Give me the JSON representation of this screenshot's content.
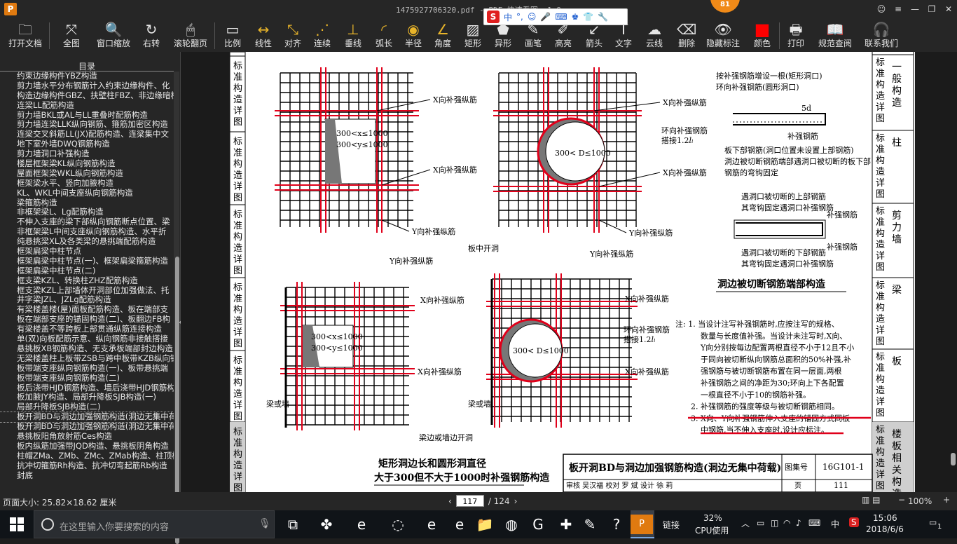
{
  "window": {
    "title": "1475927706320.pdf - PDF 快速看图 v1.9",
    "notification_count": "81"
  },
  "ime": {
    "mode": "中"
  },
  "toolbar": [
    {
      "name": "open-document",
      "label": "打开文档",
      "icon": "folder-icon"
    },
    {
      "name": "full-view",
      "label": "全图",
      "icon": "fullscreen-icon"
    },
    {
      "name": "window-zoom",
      "label": "窗口缩放",
      "icon": "magnifier-icon"
    },
    {
      "name": "rotate-right",
      "label": "右转",
      "icon": "rotate-icon"
    },
    {
      "name": "scroll-page",
      "label": "滚轮翻页",
      "icon": "mouse-icon"
    },
    {
      "name": "scale",
      "label": "比例",
      "icon": "ruler-icon"
    },
    {
      "name": "linear",
      "label": "线性",
      "icon": "linear-dim-icon"
    },
    {
      "name": "aligned",
      "label": "对齐",
      "icon": "aligned-dim-icon"
    },
    {
      "name": "continuous",
      "label": "连续",
      "icon": "continuous-dim-icon"
    },
    {
      "name": "perpendicular",
      "label": "垂线",
      "icon": "perpendicular-icon"
    },
    {
      "name": "arc-length",
      "label": "弧长",
      "icon": "arc-icon"
    },
    {
      "name": "radius",
      "label": "半径",
      "icon": "radius-icon"
    },
    {
      "name": "angle",
      "label": "角度",
      "icon": "angle-icon"
    },
    {
      "name": "rectangle",
      "label": "矩形",
      "icon": "rectangle-icon"
    },
    {
      "name": "irregular",
      "label": "异形",
      "icon": "polygon-icon"
    },
    {
      "name": "brush",
      "label": "画笔",
      "icon": "pen-icon"
    },
    {
      "name": "highlight",
      "label": "高亮",
      "icon": "highlighter-icon"
    },
    {
      "name": "arrow",
      "label": "箭头",
      "icon": "arrow-icon"
    },
    {
      "name": "text",
      "label": "文字",
      "icon": "text-icon"
    },
    {
      "name": "cloud",
      "label": "云线",
      "icon": "cloud-icon"
    },
    {
      "name": "delete",
      "label": "删除",
      "icon": "eraser-icon"
    },
    {
      "name": "hide-markup",
      "label": "隐藏标注",
      "icon": "eye-hidden-icon"
    },
    {
      "name": "color",
      "label": "颜色",
      "icon": "color-swatch-icon",
      "color": "#ff0000"
    },
    {
      "name": "print",
      "label": "打印",
      "icon": "printer-icon"
    },
    {
      "name": "spec-lookup",
      "label": "规范查阅",
      "icon": "book-icon"
    },
    {
      "name": "contact",
      "label": "联系我们",
      "icon": "headset-icon"
    }
  ],
  "sidebar": {
    "title": "目录",
    "items": [
      "约束边缘构件YBZ构造",
      "剪力墙水平分布钢筋计入约束边缘构件、化",
      "构造边缘构件GBZ、扶壁柱FBZ、非边缘暗柱",
      "连梁LL配筋构造",
      "剪力墙BKL或AL与LL重叠时配筋构造",
      "剪力墙连梁LLK纵向钢筋、箍筋加密区构造",
      "连梁交叉斜筋LL(JX)配筋构造、连梁集中文",
      "地下室外墙DWQ钢筋构造",
      "剪力墙洞口补强构造",
      "楼层框架梁KL纵向钢筋构造",
      "屋面框架梁WKL纵向钢筋构造",
      "框架梁水平、竖向加腋构造",
      "KL、WKL中间支座纵向钢筋构造",
      "梁箍筋构造",
      "非框架梁L、Lg配筋构造",
      "不伸入支座的梁下部纵向钢筋断点位置、梁",
      "非框架梁L中间支座纵向钢筋构造、水平折",
      "纯悬挑梁XL及各类梁的悬挑端配筋构造",
      "框架扁梁中柱节点",
      "框架扁梁中柱节点(一)、框架扁梁箍筋构造",
      "框架扁梁中柱节点(二)",
      "框支梁KZL、转换柱ZHZ配筋构造",
      "框支梁KZL上部墙体开洞部位加强做法、托",
      "井字梁JZL、JZLg配筋构造",
      "有梁楼盖楼(屋)面板配筋构造、板在端部支",
      "板在端部支座的锚固构造(二)、板翻边FB构",
      "有梁楼盖不等跨板上部贯通纵筋连接构造",
      "单(双)向板配筋示意、纵向钢筋非接触搭接",
      "悬挑板XB钢筋构造、无支承板端部封边构造",
      "无梁楼盖柱上板带ZSB与跨中板带KZB纵向钢",
      "板带端支座纵向钢筋构造(一)、板带悬挑端",
      "板带端支座纵向钢筋构造(二)",
      "板后浇带HJD钢筋构造、墙后浇带HJD钢筋构",
      "板加腋JY构造、局部升降板SJB构造(一)",
      "局部升降板SJB构造(二)",
      "板开洞BD与洞边加强钢筋构造(洞边无集中荷",
      "板开洞BD与洞边加强钢筋构造(洞边无集中荷",
      "悬挑板阳角放射筋Ces构造",
      "板内纵筋加强带JQD构造、悬挑板阴角构造",
      "柱帽ZMa、ZMb、ZMc、ZMab构造、柱顶柱帽",
      "抗冲切箍筋Rh构造、抗冲切弯起筋Rb构造",
      "封底"
    ],
    "selected_index": 35
  },
  "status": {
    "page_size": "页面大小: 25.82×18.62 厘米",
    "current_page": "117",
    "total_pages": "/ 124",
    "zoom": "100%"
  },
  "drawing": {
    "side_tab_left": "标准构造详图",
    "right_tabs": [
      "一般构造",
      "柱",
      "剪力墙",
      "梁",
      "板",
      "楼板相关构造"
    ],
    "right_tab_prefix": "标准构造详图",
    "labels": {
      "x_bar": "X向补强纵筋",
      "y_bar": "Y向补强纵筋",
      "ring_bar": "环向补强钢筋",
      "lap": "搭接1.2",
      "rect_size_x": "300<x≤1000",
      "rect_size_y": "300<y≤1000",
      "circle_size": "300< D≤1000",
      "slab_middle": "板中开洞",
      "beam_or_wall": "梁或墙",
      "edge_opening": "梁边或墙边开洞",
      "main_caption_1": "矩形洞边长和圆形洞直径",
      "main_caption_2": "大于300但不大于1000时补强钢筋构造",
      "right_note_1": "按补强钢筋增设一根(矩形洞口)",
      "right_note_2": "环向补强钢筋(圆形洞口)",
      "hook": "5d",
      "reinf_bar": "补强钢筋",
      "slab_bottom_1": "板下部钢筋(洞口位置未设置上部钢筋)",
      "slab_bottom_2": "洞边被切断钢筋端部遇洞口被切断的板下部",
      "slab_bottom_3": "钢筋的弯钩固定",
      "top_cut_1": "遇洞口被切断的上部钢筋",
      "top_cut_2": "其弯钩固定遇洞口补强钢筋",
      "bottom_cut_1": "遇洞口被切断的下部钢筋",
      "bottom_cut_2": "其弯钩固定遇洞口补强钢筋",
      "detail_title": "洞边被切断钢筋端部构造"
    },
    "notes": [
      "注: 1. 当设计注写补强钢筋时,应按注写的规格、",
      "数量与长度值补强。当设计未注写时,X向、",
      "Y向分别按每边配置两根直径不小于12且不小",
      "于同向被切断纵向钢筋总面积的50%补强,补",
      "强钢筋与被切断钢筋布置在同一层面,两根",
      "补强钢筋之间的净距为30;环向上下各配置",
      "一根直径不小于10的钢筋补强。",
      "2. 补强钢筋的强度等级与被切断钢筋相同。",
      "3. X向、Y向补强钢筋伸入支座的锚固方式同板",
      "中钢筋,当不伸入支座时,设计应标注。"
    ],
    "title_block": {
      "title": "板开洞BD与洞边加强钢筋构造(洞边无集中荷载)",
      "atlas_label": "图集号",
      "atlas_no": "16G101-1",
      "row2": "审核 吴汉福 校对 罗 斌 设计 徐 莉",
      "page_label": "页",
      "page_no": "111"
    },
    "markup_color": "#e0001a"
  },
  "taskbar": {
    "search_placeholder": "在这里输入你要搜索的内容",
    "link_label": "链接",
    "cpu_pct": "32%",
    "cpu_label": "CPU使用",
    "ime": "中",
    "time": "15:06",
    "date": "2018/6/6",
    "notif": "1"
  }
}
